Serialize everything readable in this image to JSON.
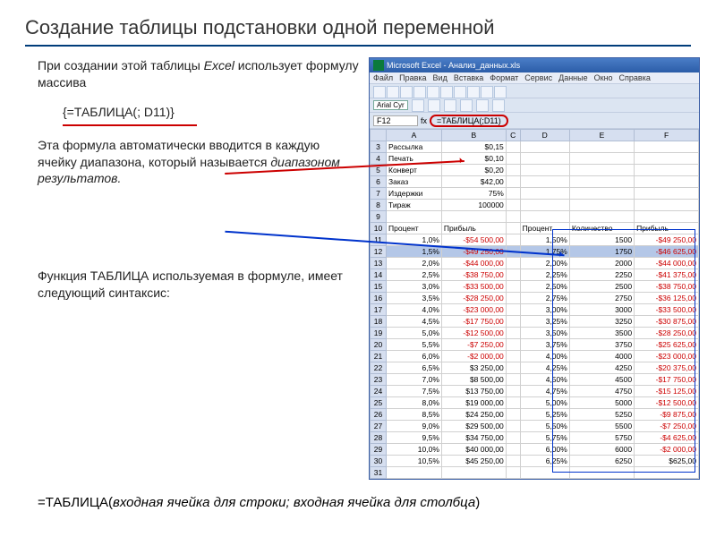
{
  "title": "Создание таблицы подстановки одной переменной",
  "para1_a": "При создании этой таблицы ",
  "para1_b": "Excel",
  "para1_c": " использует формулу массива",
  "formula": "{=ТАБЛИЦА(; D11)}",
  "para2_a": "Эта формула автоматически вводится в каждую ячейку диапазона, который называется ",
  "para2_b": "диапазоном результатов.",
  "para3": "Функция ТАБЛИЦА используемая в формуле, имеет следующий синтаксис:",
  "bottom_a": "=ТАБЛИЦА(",
  "bottom_b": "входная ячейка для строки; входная ячейка для столбца",
  "bottom_c": ")",
  "excel": {
    "title": "Microsoft Excel - Анализ_данных.xls",
    "menu": [
      "Файл",
      "Правка",
      "Вид",
      "Вставка",
      "Формат",
      "Сервис",
      "Данные",
      "Окно",
      "Справка"
    ],
    "font": "Arial Cyr",
    "cellref": "F12",
    "formulabar": "=ТАБЛИЦА(;D11)",
    "cols": [
      "A",
      "B",
      "C",
      "D",
      "E",
      "F"
    ],
    "left_data": [
      [
        "3",
        "Рассылка",
        "$0,15"
      ],
      [
        "4",
        "Печать",
        "$0,10"
      ],
      [
        "5",
        "Конверт",
        "$0,20"
      ],
      [
        "6",
        "Заказ",
        "$42,00"
      ],
      [
        "7",
        "Издержки",
        "75%"
      ],
      [
        "8",
        "Тираж",
        "100000"
      ]
    ],
    "table_header_row": "10",
    "header_left": [
      "Процент",
      "Прибыль"
    ],
    "header_right": [
      "Процент",
      "Количество",
      "Прибыль"
    ],
    "rows": [
      {
        "r": "11",
        "lp": "1,0%",
        "lv": "-$54 500,00",
        "lneg": true,
        "rp": "1,50%",
        "rq": "1500",
        "rv": "-$49 250,00",
        "rneg": true
      },
      {
        "r": "12",
        "lp": "1,5%",
        "lv": "-$49 250,00",
        "lneg": true,
        "rp": "1,75%",
        "rq": "1750",
        "rv": "-$46 625,00",
        "rneg": true,
        "sel": true
      },
      {
        "r": "13",
        "lp": "2,0%",
        "lv": "-$44 000,00",
        "lneg": true,
        "rp": "2,00%",
        "rq": "2000",
        "rv": "-$44 000,00",
        "rneg": true
      },
      {
        "r": "14",
        "lp": "2,5%",
        "lv": "-$38 750,00",
        "lneg": true,
        "rp": "2,25%",
        "rq": "2250",
        "rv": "-$41 375,00",
        "rneg": true
      },
      {
        "r": "15",
        "lp": "3,0%",
        "lv": "-$33 500,00",
        "lneg": true,
        "rp": "2,50%",
        "rq": "2500",
        "rv": "-$38 750,00",
        "rneg": true
      },
      {
        "r": "16",
        "lp": "3,5%",
        "lv": "-$28 250,00",
        "lneg": true,
        "rp": "2,75%",
        "rq": "2750",
        "rv": "-$36 125,00",
        "rneg": true
      },
      {
        "r": "17",
        "lp": "4,0%",
        "lv": "-$23 000,00",
        "lneg": true,
        "rp": "3,00%",
        "rq": "3000",
        "rv": "-$33 500,00",
        "rneg": true
      },
      {
        "r": "18",
        "lp": "4,5%",
        "lv": "-$17 750,00",
        "lneg": true,
        "rp": "3,25%",
        "rq": "3250",
        "rv": "-$30 875,00",
        "rneg": true
      },
      {
        "r": "19",
        "lp": "5,0%",
        "lv": "-$12 500,00",
        "lneg": true,
        "rp": "3,50%",
        "rq": "3500",
        "rv": "-$28 250,00",
        "rneg": true
      },
      {
        "r": "20",
        "lp": "5,5%",
        "lv": "-$7 250,00",
        "lneg": true,
        "rp": "3,75%",
        "rq": "3750",
        "rv": "-$25 625,00",
        "rneg": true
      },
      {
        "r": "21",
        "lp": "6,0%",
        "lv": "-$2 000,00",
        "lneg": true,
        "rp": "4,00%",
        "rq": "4000",
        "rv": "-$23 000,00",
        "rneg": true
      },
      {
        "r": "22",
        "lp": "6,5%",
        "lv": "$3 250,00",
        "lneg": false,
        "rp": "4,25%",
        "rq": "4250",
        "rv": "-$20 375,00",
        "rneg": true
      },
      {
        "r": "23",
        "lp": "7,0%",
        "lv": "$8 500,00",
        "lneg": false,
        "rp": "4,50%",
        "rq": "4500",
        "rv": "-$17 750,00",
        "rneg": true
      },
      {
        "r": "24",
        "lp": "7,5%",
        "lv": "$13 750,00",
        "lneg": false,
        "rp": "4,75%",
        "rq": "4750",
        "rv": "-$15 125,00",
        "rneg": true
      },
      {
        "r": "25",
        "lp": "8,0%",
        "lv": "$19 000,00",
        "lneg": false,
        "rp": "5,00%",
        "rq": "5000",
        "rv": "-$12 500,00",
        "rneg": true
      },
      {
        "r": "26",
        "lp": "8,5%",
        "lv": "$24 250,00",
        "lneg": false,
        "rp": "5,25%",
        "rq": "5250",
        "rv": "-$9 875,00",
        "rneg": true
      },
      {
        "r": "27",
        "lp": "9,0%",
        "lv": "$29 500,00",
        "lneg": false,
        "rp": "5,50%",
        "rq": "5500",
        "rv": "-$7 250,00",
        "rneg": true
      },
      {
        "r": "28",
        "lp": "9,5%",
        "lv": "$34 750,00",
        "lneg": false,
        "rp": "5,75%",
        "rq": "5750",
        "rv": "-$4 625,00",
        "rneg": true
      },
      {
        "r": "29",
        "lp": "10,0%",
        "lv": "$40 000,00",
        "lneg": false,
        "rp": "6,00%",
        "rq": "6000",
        "rv": "-$2 000,00",
        "rneg": true
      },
      {
        "r": "30",
        "lp": "10,5%",
        "lv": "$45 250,00",
        "lneg": false,
        "rp": "6,25%",
        "rq": "6250",
        "rv": "$625,00",
        "rneg": false
      }
    ],
    "empty_row": "31"
  }
}
